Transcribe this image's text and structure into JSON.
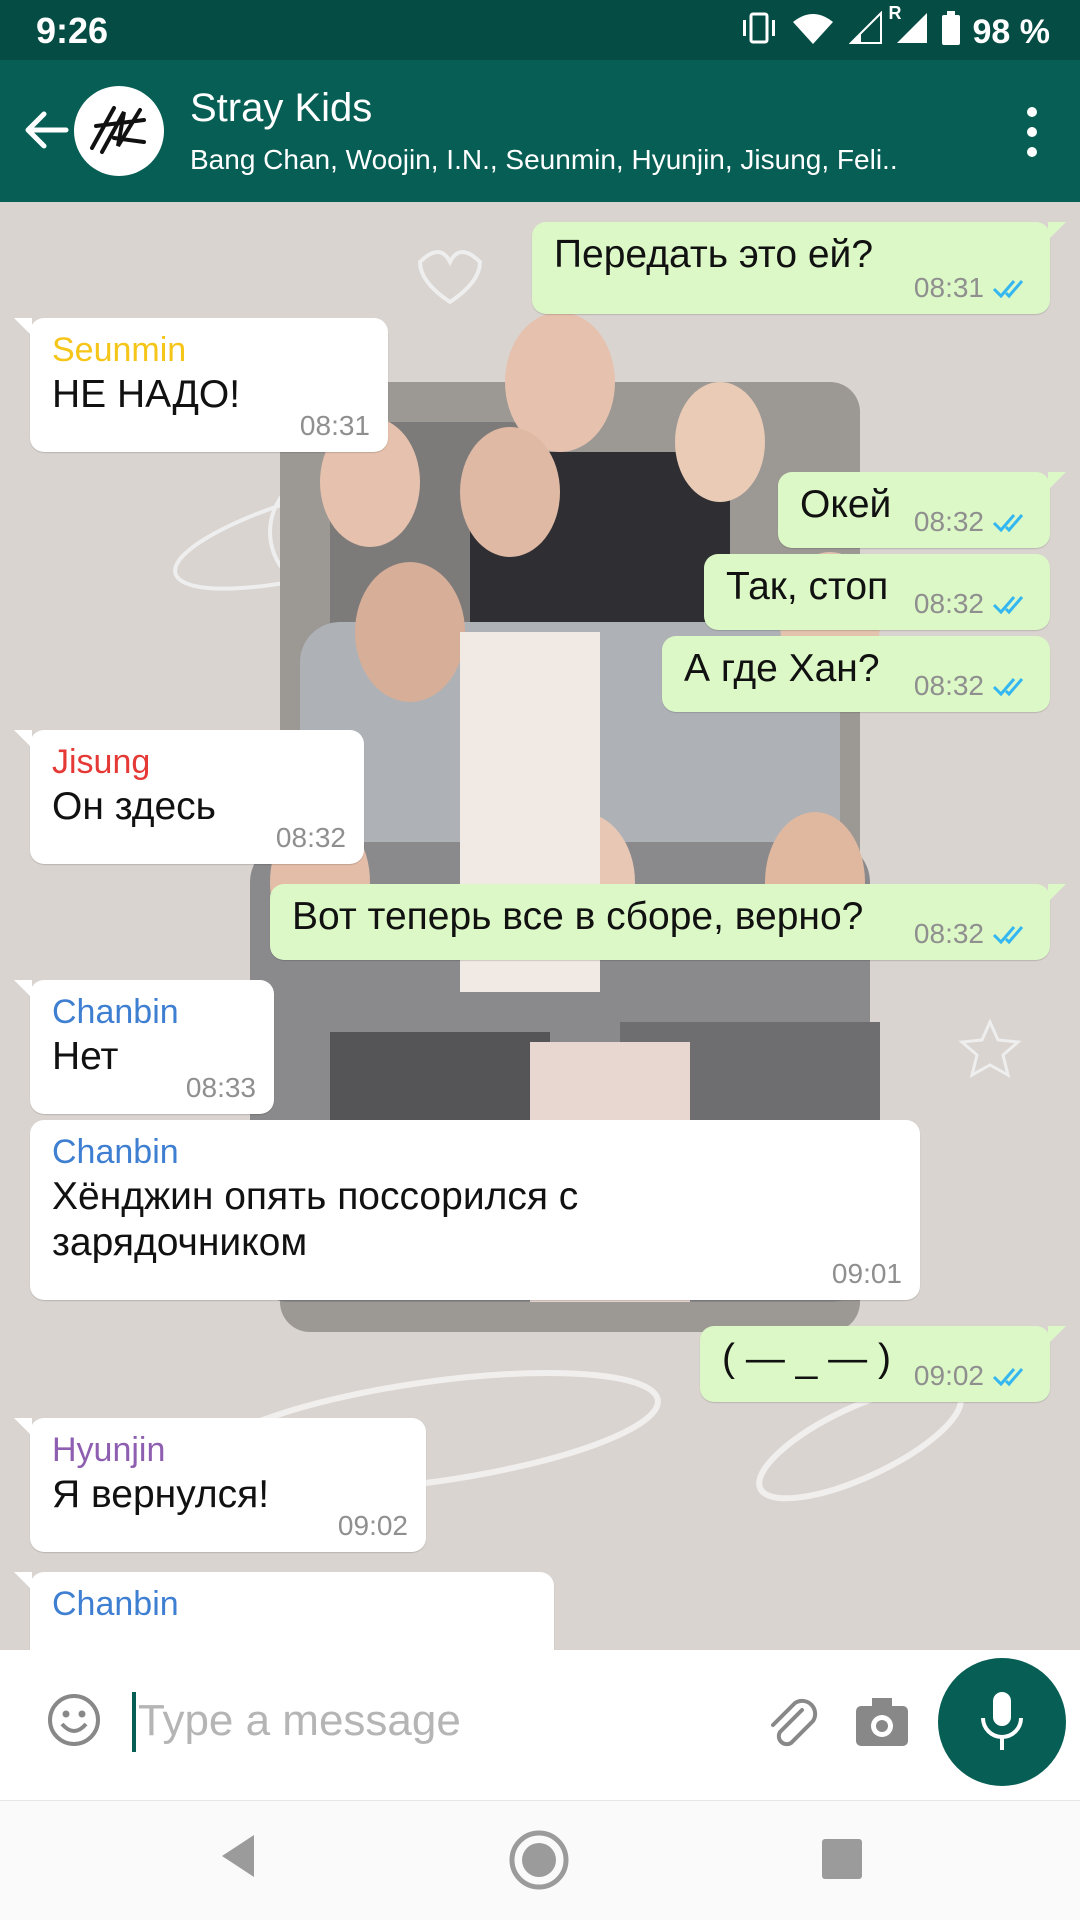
{
  "status_bar": {
    "time": "9:26",
    "roaming": "R",
    "battery": "98 %"
  },
  "header": {
    "title": "Stray Kids",
    "subtitle": "Bang Chan, Woojin, I.N., Seunmin, Hyunjin, Jisung, Feli.."
  },
  "colors": {
    "header": "#075e54",
    "status_bar": "#054d44",
    "outgoing_bubble": "#dcf8c6",
    "incoming_bubble": "#ffffff",
    "read_tick": "#34b7f1"
  },
  "messages": [
    {
      "direction": "out",
      "text": "Передать это ей?",
      "time": "08:31",
      "status": "read"
    },
    {
      "direction": "in",
      "sender": "Seunmin",
      "sender_color": "#f5c518",
      "text": "НЕ НАДО!",
      "time": "08:31"
    },
    {
      "direction": "out",
      "text": "Окей",
      "time": "08:32",
      "status": "read"
    },
    {
      "direction": "out",
      "text": "Так, стоп",
      "time": "08:32",
      "status": "read"
    },
    {
      "direction": "out",
      "text": "А где Хан?",
      "time": "08:32",
      "status": "read"
    },
    {
      "direction": "in",
      "sender": "Jisung",
      "sender_color": "#e53935",
      "text": "Он здесь",
      "time": "08:32"
    },
    {
      "direction": "out",
      "text": "Вот теперь все в сборе, верно?",
      "time": "08:32",
      "status": "read"
    },
    {
      "direction": "in",
      "sender": "Chanbin",
      "sender_color": "#3f7fd1",
      "text": "Нет",
      "time": "08:33"
    },
    {
      "direction": "in",
      "sender": "Chanbin",
      "sender_color": "#3f7fd1",
      "text": "Хёнджин опять поссорился с зарядочником",
      "time": "09:01"
    },
    {
      "direction": "out",
      "text": "( — _ — )",
      "time": "09:02",
      "status": "read"
    },
    {
      "direction": "in",
      "sender": "Hyunjin",
      "sender_color": "#8e5fb0",
      "text": "Я вернулся!",
      "time": "09:02"
    },
    {
      "direction": "in",
      "sender": "Chanbin",
      "sender_color": "#3f7fd1",
      "text": "",
      "time": ""
    }
  ],
  "composer": {
    "placeholder": "Type a message"
  },
  "icons": {
    "back": "arrow-left-icon",
    "more": "more-vert-icon",
    "emoji": "emoji-icon",
    "attach": "paperclip-icon",
    "camera": "camera-icon",
    "mic": "mic-icon"
  }
}
